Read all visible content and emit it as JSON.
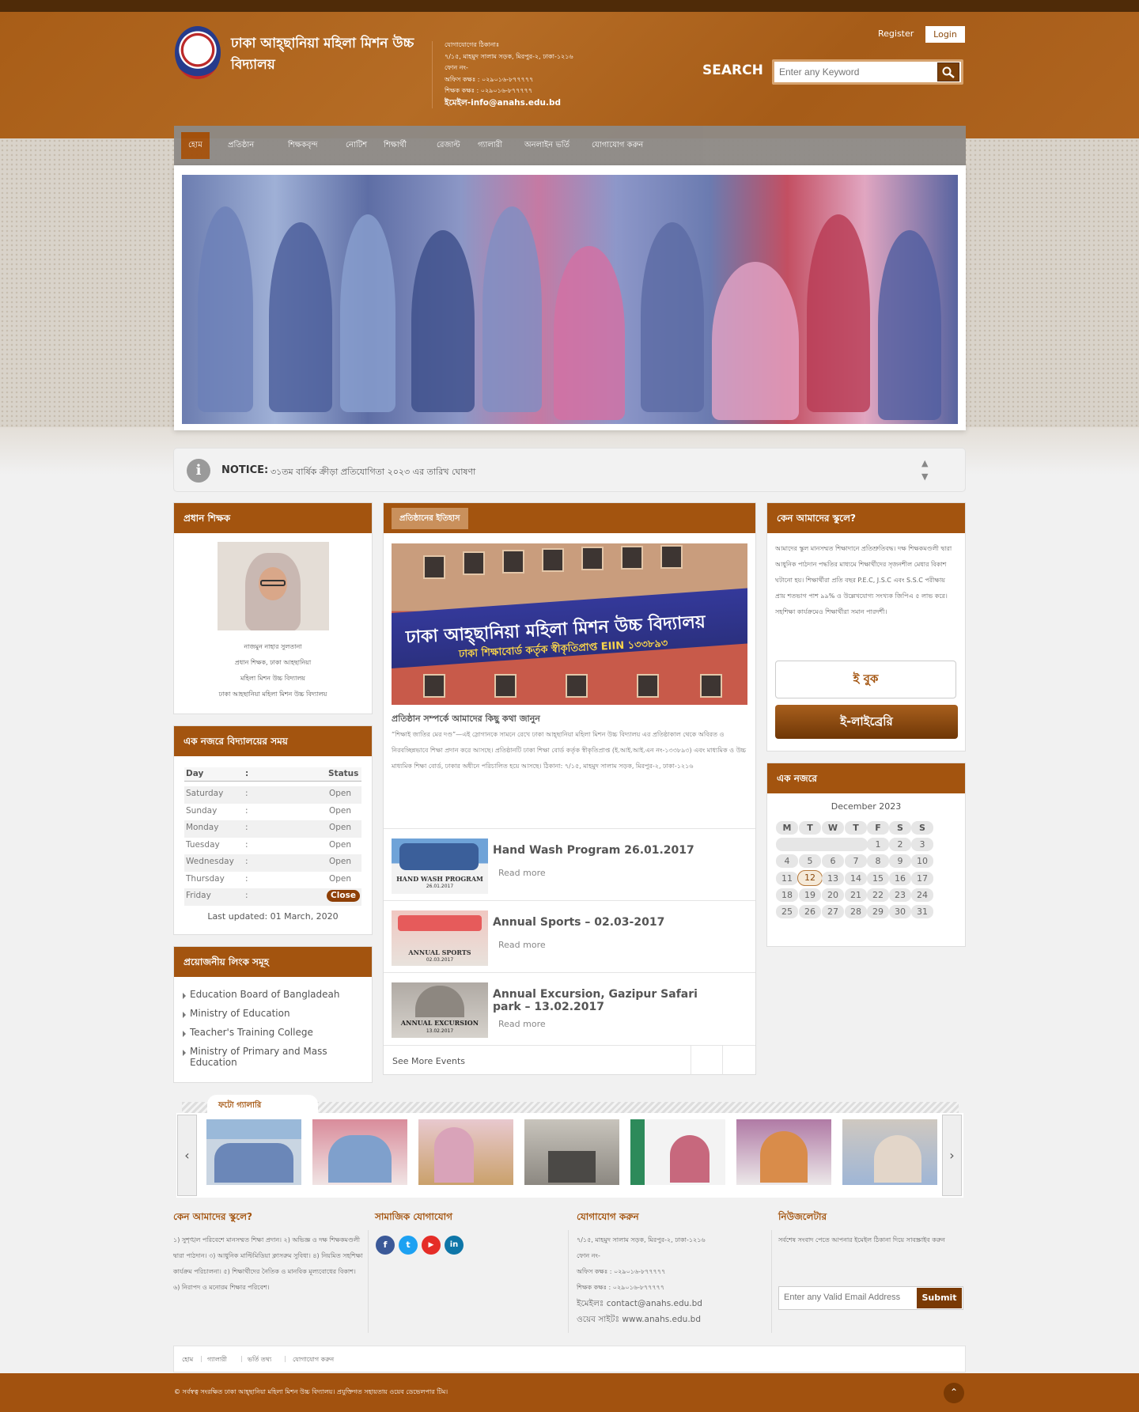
{
  "header": {
    "school_name": "ঢাকা আহ্ছানিয়া মহিলা মিশন উচ্চ বিদ্যালয়",
    "contact": {
      "line1": "যোগাযোগের ঠিকানাঃ",
      "line2": "৭/১৫, মাহমুদ সালাম সড়ক, মিরপুর-২, ঢাকা-১২১৬",
      "line3": "ফোন নং-",
      "line4": "অফিস কক্ষঃ : ০২৯০১৬-৮৭৭৭৭৭",
      "line5": "শিক্ষক কক্ষঃ : ০২৯০১৬-৮৭৭৭৭৭",
      "email": "ইমেইল-info@anahs.edu.bd"
    },
    "register_label": "Register",
    "login_label": "Login",
    "search_label": "SEARCH",
    "search_placeholder": "Enter any Keyword"
  },
  "nav": {
    "items": [
      "হোম",
      "প্রতিষ্ঠান",
      "শিক্ষকবৃন্দ",
      "নোটিশ",
      "শিক্ষার্থী",
      "রেজাল্ট",
      "গ্যালারী",
      "অনলাইন ভর্তি",
      "যোগাযোগ করুন"
    ]
  },
  "notice": {
    "label": "NOTICE:",
    "text": "৩১তম বার্ষিক ক্রীড়া প্রতিযোগিতা ২০২৩ এর তারিখ ঘোষণা"
  },
  "head_teacher": {
    "title": "প্রধান শিক্ষক",
    "name": "নাজমুন নাহার সুলতানা",
    "line2": "প্রধান শিক্ষক, ঢাকা আহছানিয়া",
    "line3": "মহিলা মিশন উচ্চ বিদ্যালয়",
    "line4": "ঢাকা আহছানিয়া মহিলা মিশন উচ্চ বিদ্যালয়"
  },
  "schedule": {
    "title": "এক নজরে বিদ্যালয়ের সময়",
    "head": {
      "day": "Day",
      "sep": ":",
      "status": "Status"
    },
    "rows": [
      {
        "day": "Saturday",
        "status": "Open"
      },
      {
        "day": "Sunday",
        "status": "Open"
      },
      {
        "day": "Monday",
        "status": "Open"
      },
      {
        "day": "Tuesday",
        "status": "Open"
      },
      {
        "day": "Wednesday",
        "status": "Open"
      },
      {
        "day": "Thursday",
        "status": "Open"
      },
      {
        "day": "Friday",
        "status": "Close"
      }
    ],
    "updated": "Last updated: 01 March, 2020"
  },
  "useful_links": {
    "title": "প্রয়োজনীয় লিংক সমূহ",
    "items": [
      "Education Board of Bangladeah",
      "Ministry of Education",
      "Teacher's Training College",
      "Ministry of Primary and Mass Education"
    ]
  },
  "achievement": {
    "tag": "প্রতিষ্ঠানের ইতিহাস",
    "photo_banner_1": "ঢাকা আহ্ছানিয়া মহিলা মিশন উচ্চ বিদ্যালয়",
    "photo_banner_2": "ঢাকা শিক্ষাবোর্ড কর্তৃক স্বীকৃতিপ্রাপ্ত EIIN ১৩৩৮৯৩",
    "heading": "প্রতিষ্ঠান সম্পর্কে আমাদের কিছু কথা জানুন",
    "body": "“শিক্ষাই জাতির মের দণ্ড”—এই স্লোগানকে সামনে রেখে ঢাকা আহ্ছানিয়া মহিলা মিশন উচ্চ বিদ্যালয় এর প্রতিষ্ঠাকাল থেকে অবিরত ও নিরবচ্ছিন্নভাবে শিক্ষা প্রদান করে আসছে। প্রতিষ্ঠানটি ঢাকা শিক্ষা বোর্ড কর্তৃক স্বীকৃতিপ্রাপ্ত (ই.আই.আই.এন নং-১৩৩৮৯৩) এবং মাধ্যমিক ও উচ্চ মাধ্যমিক শিক্ষা বোর্ড, ঢাকার অধীনে পরিচালিত হয়ে আসছে। ঠিকানা: ৭/১৫, মাহমুদ সালাম সড়ক, মিরপুর-২, ঢাকা-১২১৬"
  },
  "events": [
    {
      "title": "Hand Wash Program 26.01.2017",
      "read_more": "Read more",
      "thumb_label": "HAND WASH PROGRAM",
      "thumb_date": "26.01.2017"
    },
    {
      "title": "Annual Sports – 02.03-2017",
      "read_more": "Read more",
      "thumb_label": "ANNUAL SPORTS",
      "thumb_date": "02.03.2017"
    },
    {
      "title": "Annual Excursion, Gazipur Safari park – 13.02.2017",
      "read_more": "Read more",
      "thumb_label": "ANNUAL EXCURSION",
      "thumb_date": "13.02.2017"
    }
  ],
  "see_more": "See More Events",
  "why_us": {
    "title": "কেন আমাদের স্কুলে?",
    "text": "আমাদের স্কুল মানসম্মত শিক্ষাদানে প্রতিশ্রুতিবদ্ধ। দক্ষ শিক্ষকমণ্ডলী দ্বারা আধুনিক পাঠদান পদ্ধতির মাধ্যমে শিক্ষার্থীদের সৃজনশীল মেধার বিকাশ ঘটানো হয়। শিক্ষার্থীরা প্রতি বছর P.E.C, J.S.C এবং S.S.C পরীক্ষায় প্রায় শতভাগ পাশ ৯৯% ও উল্লেখযোগ্য সংখ্যক জিপিএ ৫ লাভ করে। সহশিক্ষা কার্যক্রমেও শিক্ষার্থীরা সমান পারদর্শী।",
    "btn_outline": "ই বুক",
    "btn_filled": "ই-লাইব্রেরি"
  },
  "calendar": {
    "title": "এক নজরে",
    "month": "December 2023",
    "weekdays": [
      "M",
      "T",
      "W",
      "T",
      "F",
      "S",
      "S"
    ],
    "today": "12",
    "weeks": [
      [
        "",
        "",
        "",
        "",
        "1",
        "2",
        "3"
      ],
      [
        "4",
        "5",
        "6",
        "7",
        "8",
        "9",
        "10"
      ],
      [
        "11",
        "12",
        "13",
        "14",
        "15",
        "16",
        "17"
      ],
      [
        "18",
        "19",
        "20",
        "21",
        "22",
        "23",
        "24"
      ],
      [
        "25",
        "26",
        "27",
        "28",
        "29",
        "30",
        "31"
      ]
    ]
  },
  "gallery": {
    "title": "ফটো গ্যালারি",
    "prev": "‹",
    "next": "›"
  },
  "footer": {
    "why_title": "কেন আমাদের স্কুলে?",
    "why_text": "১) সুশৃঙ্খল পরিবেশে মানসম্মত শিক্ষা প্রদান। ২) অভিজ্ঞ ও দক্ষ শিক্ষকমণ্ডলী দ্বারা পাঠদান। ৩) আধুনিক মাল্টিমিডিয়া ক্লাসরুম সুবিধা। ৪) নিয়মিত সহশিক্ষা কার্যক্রম পরিচালনা। ৫) শিক্ষার্থীদের নৈতিক ও মানবিক মূল্যবোধের বিকাশ। ৬) নিরাপদ ও মনোরম শিক্ষার পরিবেশ।",
    "social_title": "সামাজিক যোগাযোগ",
    "social": [
      "f",
      "t",
      "▶",
      "in"
    ],
    "contact_title": "যোগাযোগ করুন",
    "contact_l1": "৭/১৫, মাহমুদ সালাম সড়ক, মিরপুর-২, ঢাকা-১২১৬",
    "contact_l2": "ফোন নং-",
    "contact_l3": "অফিস কক্ষঃ : ০২৯০১৬-৮৭৭৭৭৭",
    "contact_l4": "শিক্ষক কক্ষঃ : ০২৯০১৬-৮৭৭৭৭৭",
    "contact_email": "ইমেইলঃ contact@anahs.edu.bd",
    "contact_web": "ওয়েব সাইটঃ www.anahs.edu.bd",
    "news_title": "নিউজলেটার",
    "news_text": "সর্বশেষ সংবাদ পেতে আপনার ইমেইল ঠিকানা দিয়ে সাবস্ক্রাইব করুন",
    "news_placeholder": "Enter any Valid Email Address",
    "submit": "Submit",
    "links": [
      "হোম",
      "গ্যালারী",
      "ভর্তি তথ্য",
      "যোগাযোগ করুন"
    ],
    "copyright": "© সর্বস্বত্ব সংরক্ষিত ঢাকা আহ্ছানিয়া মহিলা মিশন উচ্চ বিদ্যালয়। প্রযুক্তিগত সহায়তায় ওয়েব ডেভেলপার টিম।",
    "to_top": "⌃"
  },
  "colors": {
    "brand": "#a3540f",
    "brand_dark": "#7a3a04",
    "topbar": "#4f2b08",
    "nav": "#8e8a86"
  }
}
